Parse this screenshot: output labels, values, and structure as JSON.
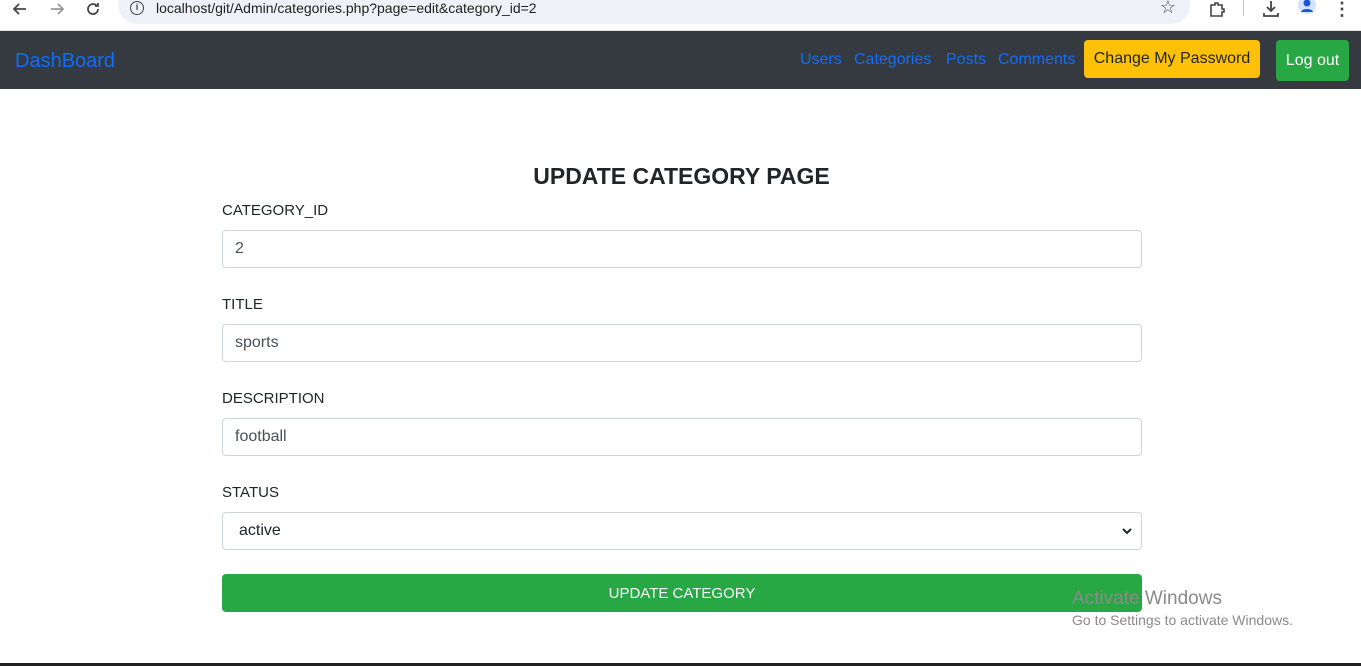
{
  "browser": {
    "url": "localhost/git/Admin/categories.php?page=edit&category_id=2",
    "icons": [
      "back-arrow-icon",
      "forward-arrow-icon",
      "reload-icon",
      "site-info-icon",
      "bookmark-star-icon",
      "extensions-icon",
      "download-icon",
      "profile-icon",
      "menu-dots-icon"
    ]
  },
  "navbar": {
    "brand": "DashBoard",
    "links": [
      "Users",
      "Categories",
      "Posts",
      "Comments"
    ],
    "change_password": "Change My Password",
    "logout": "Log out",
    "colors": {
      "bg": "#343a40",
      "link": "#0d6efd",
      "warning": "#ffc107",
      "success": "#28a745"
    }
  },
  "form": {
    "title": "UPDATE CATEGORY PAGE",
    "category_id_label": "CATEGORY_ID",
    "category_id_value": "2",
    "title_label": "TITLE",
    "title_value": "sports",
    "description_label": "DESCRIPTION",
    "description_value": "football",
    "status_label": "STATUS",
    "status_value": "active",
    "submit": "UPDATE CATEGORY"
  },
  "watermark": {
    "line1": "Activate Windows",
    "line2": "Go to Settings to activate Windows."
  }
}
